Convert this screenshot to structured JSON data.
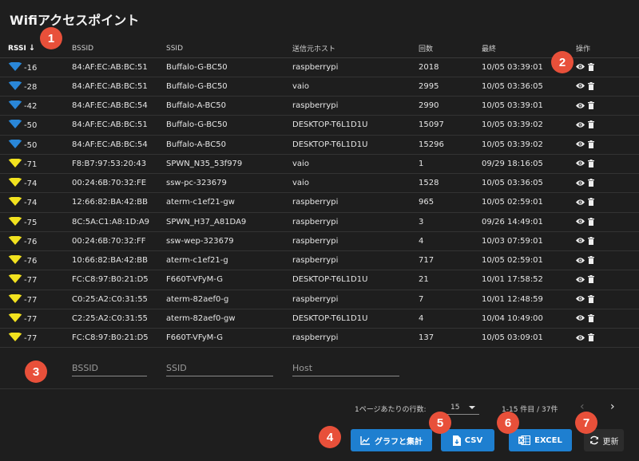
{
  "title": "Wifiアクセスポイント",
  "columns": {
    "rssi": "RSSI",
    "bssid": "BSSID",
    "ssid": "SSID",
    "host": "送信元ホスト",
    "count": "回数",
    "last": "最終",
    "ops": "操作"
  },
  "rows": [
    {
      "rssi": "-16",
      "level": "strong",
      "bssid": "84:AF:EC:AB:BC:51",
      "ssid": "Buffalo-G-BC50",
      "host": "raspberrypi",
      "count": "2018",
      "last": "10/05 03:39:01"
    },
    {
      "rssi": "-28",
      "level": "strong",
      "bssid": "84:AF:EC:AB:BC:51",
      "ssid": "Buffalo-G-BC50",
      "host": "vaio",
      "count": "2995",
      "last": "10/05 03:36:05"
    },
    {
      "rssi": "-42",
      "level": "strong",
      "bssid": "84:AF:EC:AB:BC:54",
      "ssid": "Buffalo-A-BC50",
      "host": "raspberrypi",
      "count": "2990",
      "last": "10/05 03:39:01"
    },
    {
      "rssi": "-50",
      "level": "strong",
      "bssid": "84:AF:EC:AB:BC:51",
      "ssid": "Buffalo-G-BC50",
      "host": "DESKTOP-T6L1D1U",
      "count": "15097",
      "last": "10/05 03:39:02"
    },
    {
      "rssi": "-50",
      "level": "strong",
      "bssid": "84:AF:EC:AB:BC:54",
      "ssid": "Buffalo-A-BC50",
      "host": "DESKTOP-T6L1D1U",
      "count": "15296",
      "last": "10/05 03:39:02"
    },
    {
      "rssi": "-71",
      "level": "weak",
      "bssid": "F8:B7:97:53:20:43",
      "ssid": "SPWN_N35_53f979",
      "host": "vaio",
      "count": "1",
      "last": "09/29 18:16:05"
    },
    {
      "rssi": "-74",
      "level": "weak",
      "bssid": "00:24:6B:70:32:FE",
      "ssid": "ssw-pc-323679",
      "host": "vaio",
      "count": "1528",
      "last": "10/05 03:36:05"
    },
    {
      "rssi": "-74",
      "level": "weak",
      "bssid": "12:66:82:BA:42:BB",
      "ssid": "aterm-c1ef21-gw",
      "host": "raspberrypi",
      "count": "965",
      "last": "10/05 02:59:01"
    },
    {
      "rssi": "-75",
      "level": "weak",
      "bssid": "8C:5A:C1:A8:1D:A9",
      "ssid": "SPWN_H37_A81DA9",
      "host": "raspberrypi",
      "count": "3",
      "last": "09/26 14:49:01"
    },
    {
      "rssi": "-76",
      "level": "weak",
      "bssid": "00:24:6B:70:32:FF",
      "ssid": "ssw-wep-323679",
      "host": "raspberrypi",
      "count": "4",
      "last": "10/03 07:59:01"
    },
    {
      "rssi": "-76",
      "level": "weak",
      "bssid": "10:66:82:BA:42:BB",
      "ssid": "aterm-c1ef21-g",
      "host": "raspberrypi",
      "count": "717",
      "last": "10/05 02:59:01"
    },
    {
      "rssi": "-77",
      "level": "weak",
      "bssid": "FC:C8:97:B0:21:D5",
      "ssid": "F660T-VFyM-G",
      "host": "DESKTOP-T6L1D1U",
      "count": "21",
      "last": "10/01 17:58:52"
    },
    {
      "rssi": "-77",
      "level": "weak",
      "bssid": "C0:25:A2:C0:31:55",
      "ssid": "aterm-82aef0-g",
      "host": "raspberrypi",
      "count": "7",
      "last": "10/01 12:48:59"
    },
    {
      "rssi": "-77",
      "level": "weak",
      "bssid": "C2:25:A2:C0:31:55",
      "ssid": "aterm-82aef0-gw",
      "host": "DESKTOP-T6L1D1U",
      "count": "4",
      "last": "10/04 10:49:00"
    },
    {
      "rssi": "-77",
      "level": "weak",
      "bssid": "FC:C8:97:B0:21:D5",
      "ssid": "F660T-VFyM-G",
      "host": "raspberrypi",
      "count": "137",
      "last": "10/05 03:09:01"
    }
  ],
  "filters": {
    "bssid_placeholder": "BSSID",
    "ssid_placeholder": "SSID",
    "host_placeholder": "Host"
  },
  "pager": {
    "rows_per_page_label": "1ページあたりの行数:",
    "rows_per_page": "15",
    "range": "1-15 件目 / 37件",
    "prev": "‹",
    "next": "›"
  },
  "buttons": {
    "graph": "グラフと集計",
    "csv": "CSV",
    "excel": "EXCEL",
    "refresh": "更新"
  },
  "badges": [
    "1",
    "2",
    "3",
    "4",
    "5",
    "6",
    "7"
  ],
  "colors": {
    "strong_signal": "#2a87d8",
    "weak_signal": "#f2e21f",
    "primary_button": "#1e7fd0",
    "badge": "#e8503a"
  }
}
